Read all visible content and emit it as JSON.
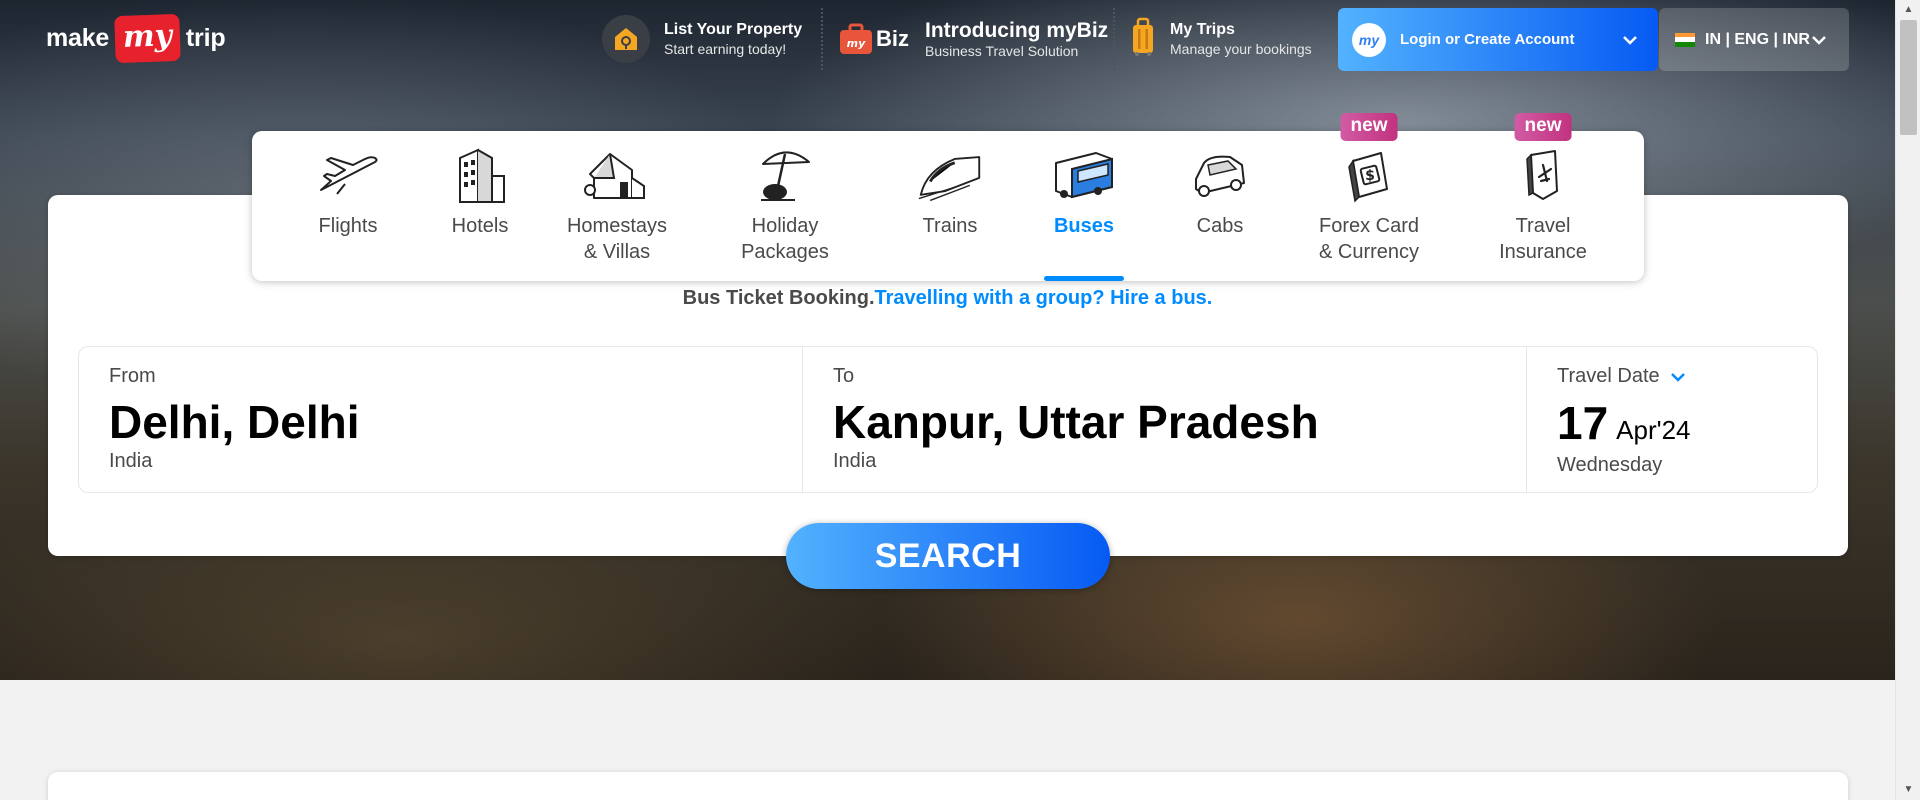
{
  "header": {
    "logo": {
      "make": "make",
      "my": "my",
      "trip": "trip"
    },
    "list_property": {
      "title": "List Your Property",
      "subtitle": "Start earning today!"
    },
    "mybiz": {
      "badge": "Biz",
      "title": "Introducing myBiz",
      "subtitle": "Business Travel Solution"
    },
    "my_trips": {
      "title": "My Trips",
      "subtitle": "Manage your bookings"
    },
    "login": {
      "label": "Login or Create Account"
    },
    "locale": {
      "label": "IN | ENG | INR"
    }
  },
  "categories": [
    {
      "label": "Flights",
      "icon": "plane-icon",
      "active": false,
      "new": false
    },
    {
      "label": "Hotels",
      "icon": "hotel-building-icon",
      "active": false,
      "new": false
    },
    {
      "label": "Homestays\n& Villas",
      "icon": "house-icon",
      "active": false,
      "new": false
    },
    {
      "label": "Holiday\nPackages",
      "icon": "beach-umbrella-icon",
      "active": false,
      "new": false
    },
    {
      "label": "Trains",
      "icon": "train-icon",
      "active": false,
      "new": false
    },
    {
      "label": "Buses",
      "icon": "bus-icon",
      "active": true,
      "new": false
    },
    {
      "label": "Cabs",
      "icon": "cab-icon",
      "active": false,
      "new": false
    },
    {
      "label": "Forex Card\n& Currency",
      "icon": "forex-card-icon",
      "active": false,
      "new": true
    },
    {
      "label": "Travel\nInsurance",
      "icon": "insurance-icon",
      "active": false,
      "new": true
    }
  ],
  "new_badge": "new",
  "tagline": {
    "text": "Bus Ticket Booking.",
    "link": "Travelling with a group? Hire a bus."
  },
  "search": {
    "from": {
      "label": "From",
      "city": "Delhi, Delhi",
      "country": "India"
    },
    "to": {
      "label": "To",
      "city": "Kanpur, Uttar Pradesh",
      "country": "India"
    },
    "date": {
      "label": "Travel Date",
      "day": "17",
      "month_year": "Apr'24",
      "weekday": "Wednesday"
    },
    "button": "SEARCH"
  },
  "colors": {
    "brand_blue": "#008cff",
    "logo_red": "#e8222d",
    "badge_pink": "#c2327f"
  }
}
